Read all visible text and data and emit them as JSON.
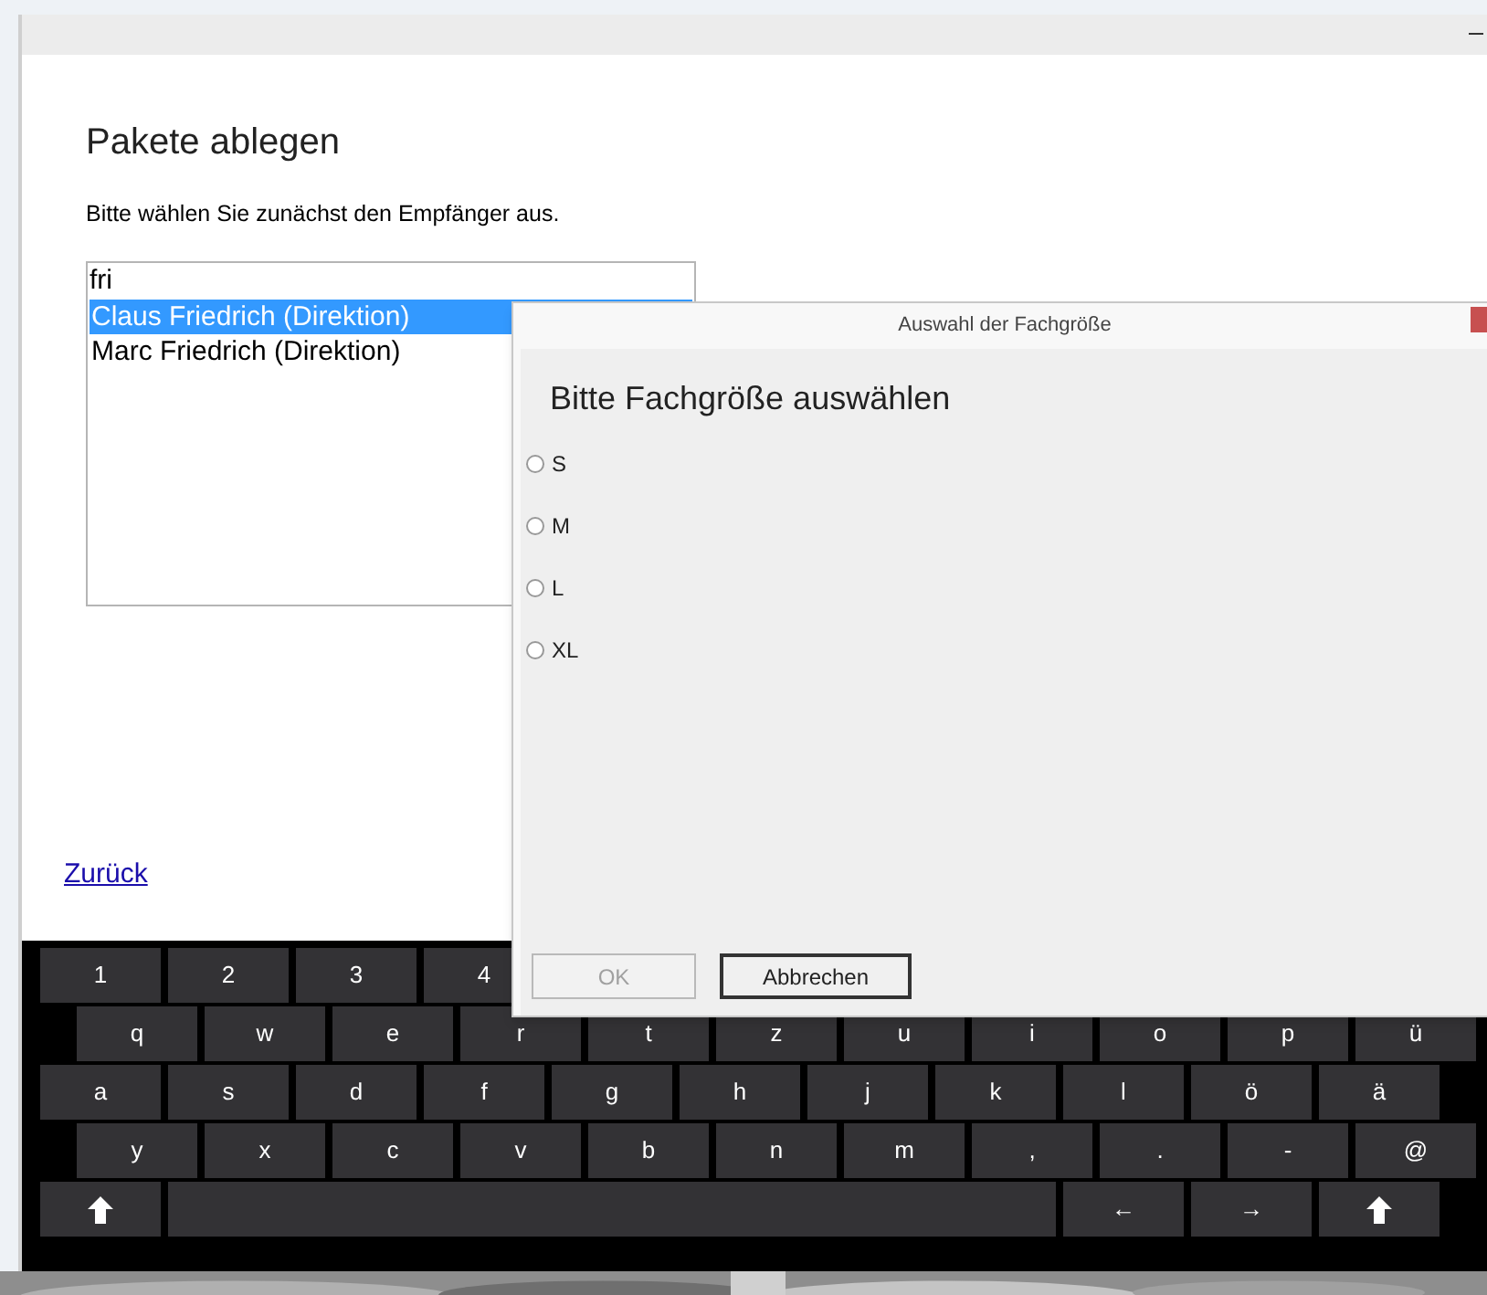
{
  "window": {
    "title": "Pakete ablegen",
    "instruction": "Bitte wählen Sie zunächst den Empfänger aus."
  },
  "recipient": {
    "search_value": "fri",
    "items": [
      {
        "label": "Claus Friedrich (Direktion)",
        "selected": true
      },
      {
        "label": "Marc Friedrich (Direktion)",
        "selected": false
      }
    ]
  },
  "back_link": "Zurück",
  "dialog": {
    "title": "Auswahl der Fachgröße",
    "heading": "Bitte Fachgröße auswählen",
    "options": [
      {
        "label": "S",
        "selected": false
      },
      {
        "label": "M",
        "selected": false
      },
      {
        "label": "L",
        "selected": false
      },
      {
        "label": "XL",
        "selected": false
      }
    ],
    "buttons": [
      {
        "label": "OK",
        "disabled": true
      },
      {
        "label": "Abbrechen",
        "disabled": false
      }
    ]
  },
  "keyboard": {
    "rows": [
      [
        {
          "kind": "key",
          "label": "1"
        },
        {
          "kind": "key",
          "label": "2"
        },
        {
          "kind": "key",
          "label": "3"
        },
        {
          "kind": "key",
          "label": "4"
        }
      ],
      [
        {
          "kind": "key",
          "label": "q"
        },
        {
          "kind": "key",
          "label": "w"
        },
        {
          "kind": "key",
          "label": "e"
        },
        {
          "kind": "key",
          "label": "r"
        },
        {
          "kind": "key",
          "label": "t"
        },
        {
          "kind": "key",
          "label": "z"
        },
        {
          "kind": "key",
          "label": "u"
        },
        {
          "kind": "key",
          "label": "i"
        },
        {
          "kind": "key",
          "label": "o"
        },
        {
          "kind": "key",
          "label": "p"
        },
        {
          "kind": "key",
          "label": "ü"
        }
      ],
      [
        {
          "kind": "key",
          "label": "a"
        },
        {
          "kind": "key",
          "label": "s"
        },
        {
          "kind": "key",
          "label": "d"
        },
        {
          "kind": "key",
          "label": "f"
        },
        {
          "kind": "key",
          "label": "g"
        },
        {
          "kind": "key",
          "label": "h"
        },
        {
          "kind": "key",
          "label": "j"
        },
        {
          "kind": "key",
          "label": "k"
        },
        {
          "kind": "key",
          "label": "l"
        },
        {
          "kind": "key",
          "label": "ö"
        },
        {
          "kind": "key",
          "label": "ä"
        }
      ],
      [
        {
          "kind": "key",
          "label": "y"
        },
        {
          "kind": "key",
          "label": "x"
        },
        {
          "kind": "key",
          "label": "c"
        },
        {
          "kind": "key",
          "label": "v"
        },
        {
          "kind": "key",
          "label": "b"
        },
        {
          "kind": "key",
          "label": "n"
        },
        {
          "kind": "key",
          "label": "m"
        },
        {
          "kind": "key",
          "label": ","
        },
        {
          "kind": "key",
          "label": "."
        },
        {
          "kind": "key",
          "label": "-"
        },
        {
          "kind": "key",
          "label": "@"
        }
      ],
      [
        {
          "kind": "shift"
        },
        {
          "kind": "space"
        },
        {
          "kind": "key",
          "label": "←"
        },
        {
          "kind": "key",
          "label": "→"
        },
        {
          "kind": "shift"
        }
      ]
    ]
  }
}
